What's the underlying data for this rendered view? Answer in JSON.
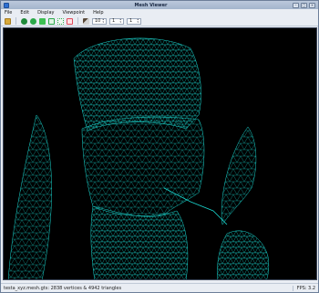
{
  "window": {
    "title": "Mesh Viewer"
  },
  "menu": {
    "items": [
      "File",
      "Edit",
      "Display",
      "Viewpoint",
      "Help"
    ]
  },
  "toolbar": {
    "icons": [
      {
        "name": "open-folder-icon",
        "color": "#d9a93a"
      },
      {
        "name": "solid-shading-icon",
        "color": "#1f8a3a"
      },
      {
        "name": "smooth-shading-icon",
        "color": "#2aa84a"
      },
      {
        "name": "flat-shading-icon",
        "color": "#3cbf52"
      },
      {
        "name": "wireframe-icon",
        "color": "#4cc96a"
      },
      {
        "name": "points-icon",
        "color": "#7ad98c"
      },
      {
        "name": "reset-icon",
        "color": "#e0485a"
      },
      {
        "name": "light-icon",
        "color": "#5a4a3a"
      }
    ],
    "spin1": {
      "value": "10"
    },
    "spin2": {
      "value": "1"
    },
    "spin3": {
      "value": "1"
    }
  },
  "viewport": {
    "background": "#000000",
    "mesh_color": "#19d6cf"
  },
  "status": {
    "left": "testa_xyz.mesh.gts: 2838 vertices & 4942 triangles",
    "fps": "FPS: 3.2"
  }
}
